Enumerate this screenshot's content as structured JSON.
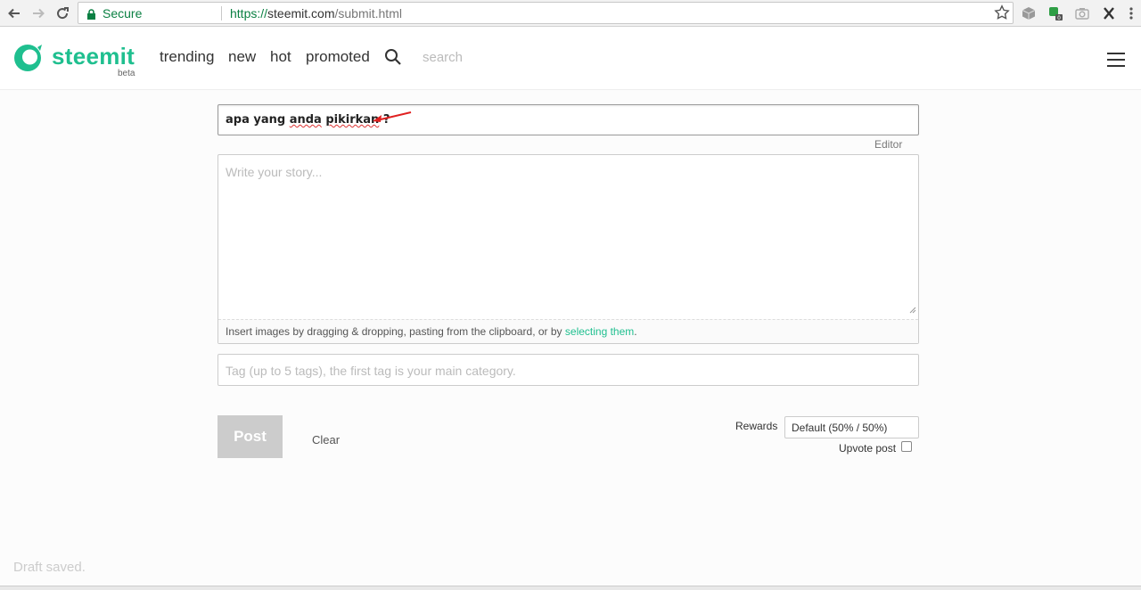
{
  "browser": {
    "secure_label": "Secure",
    "url_scheme": "https://",
    "url_host": "steemit.com",
    "url_path": "/submit.html"
  },
  "header": {
    "brand": "steemit",
    "beta": "beta",
    "nav": [
      "trending",
      "new",
      "hot",
      "promoted"
    ],
    "search_placeholder": "search",
    "accent_color": "#1fbf8f"
  },
  "form": {
    "title_value_plain": "apa yang ",
    "title_value_typo1": "anda",
    "title_value_sep": " ",
    "title_value_typo2": "pikirkan",
    "title_value_end": " ?",
    "editor_label": "Editor",
    "story_placeholder": "Write your story...",
    "dropzone_text": "Insert images by dragging & dropping, pasting from the clipboard, or by ",
    "dropzone_link": "selecting them",
    "dropzone_end": ".",
    "tag_placeholder": "Tag (up to 5 tags), the first tag is your main category.",
    "post_label": "Post",
    "clear_label": "Clear",
    "rewards_label": "Rewards",
    "rewards_value": "Default (50% / 50%)",
    "upvote_label": "Upvote post",
    "upvote_checked": false
  },
  "status": {
    "draft": "Draft saved."
  }
}
